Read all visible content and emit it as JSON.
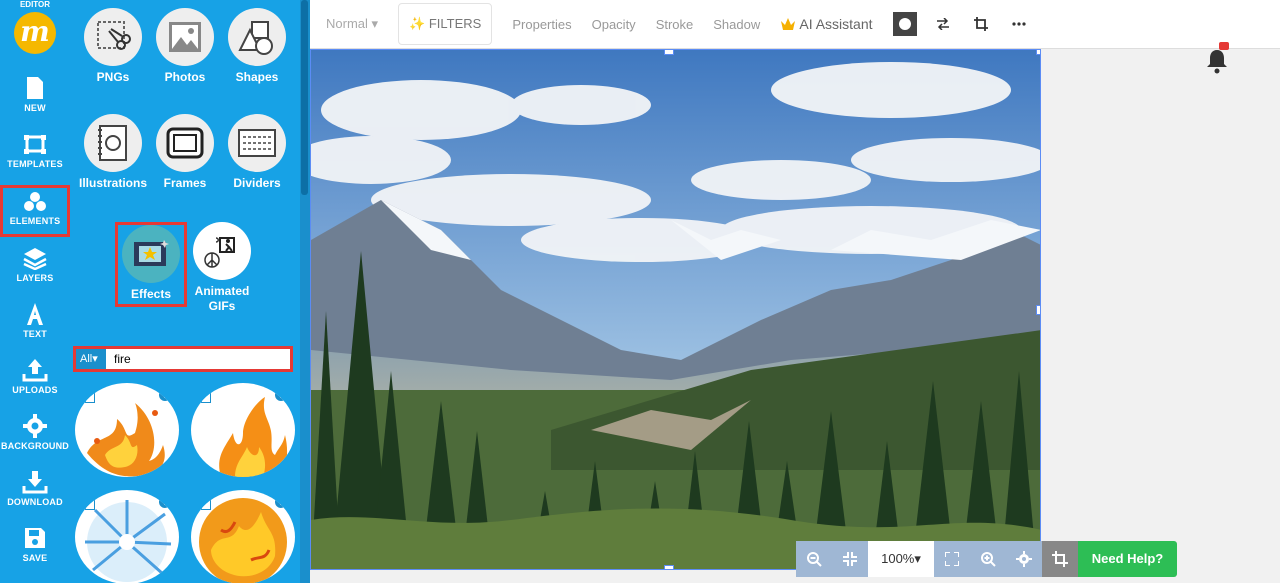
{
  "app": {
    "brand": "EDITOR",
    "logo_letter": "m"
  },
  "rail": {
    "items": [
      {
        "label": "NEW"
      },
      {
        "label": "TEMPLATES"
      },
      {
        "label": "ELEMENTS"
      },
      {
        "label": "LAYERS"
      },
      {
        "label": "TEXT"
      },
      {
        "label": "UPLOADS"
      },
      {
        "label": "BACKGROUND"
      },
      {
        "label": "DOWNLOAD"
      },
      {
        "label": "SAVE"
      }
    ]
  },
  "panel": {
    "categories": [
      {
        "label": "PNGs"
      },
      {
        "label": "Photos"
      },
      {
        "label": "Shapes"
      },
      {
        "label": "Illustrations"
      },
      {
        "label": "Frames"
      },
      {
        "label": "Dividers"
      },
      {
        "label": "Effects"
      },
      {
        "label": "Animated GIFs"
      }
    ],
    "search": {
      "filter": "All▾",
      "value": "fire"
    }
  },
  "toolbar": {
    "blend_mode": "Normal ▾",
    "filters": "FILTERS",
    "properties": "Properties",
    "opacity": "Opacity",
    "stroke": "Stroke",
    "shadow": "Shadow",
    "ai_assistant": "AI Assistant"
  },
  "zoom": {
    "value": "100%▾"
  },
  "help": {
    "label": "Need Help?"
  },
  "colors": {
    "accent": "#17a2e6",
    "highlight": "#e53935",
    "help": "#2dbe55"
  }
}
